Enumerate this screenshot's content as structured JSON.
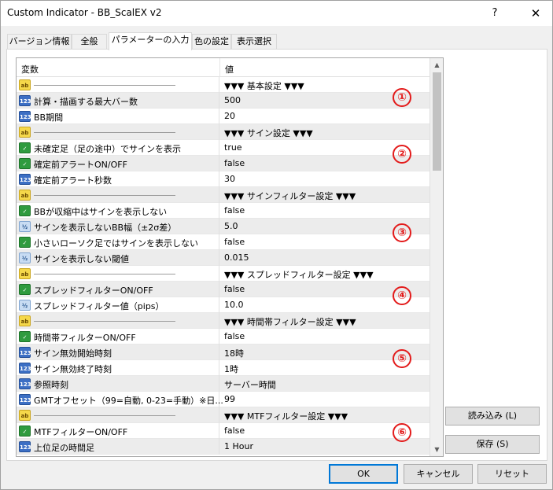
{
  "window": {
    "title": "Custom Indicator - BB_ScalEX v2",
    "help_label": "?",
    "close_label": "✕"
  },
  "tabs": [
    {
      "label": "バージョン情報"
    },
    {
      "label": "全般"
    },
    {
      "label": "パラメーターの入力"
    },
    {
      "label": "色の設定"
    },
    {
      "label": "表示選択"
    }
  ],
  "grid": {
    "header_variable": "変数",
    "header_value": "値"
  },
  "rows": [
    {
      "type": "ab",
      "icon": "ab",
      "variable": "",
      "value": "▼▼▼ 基本設定 ▼▼▼",
      "separator": true
    },
    {
      "type": "int",
      "icon": "123",
      "variable": "計算・描画する最大バー数",
      "value": "500"
    },
    {
      "type": "int",
      "icon": "123",
      "variable": "BB期間",
      "value": "20"
    },
    {
      "type": "ab",
      "icon": "ab",
      "variable": "",
      "value": "▼▼▼ サイン設定 ▼▼▼",
      "separator": true
    },
    {
      "type": "bool",
      "icon": "✓",
      "variable": "未確定足（足の途中）でサインを表示",
      "value": "true"
    },
    {
      "type": "bool",
      "icon": "✓",
      "variable": "確定前アラートON/OFF",
      "value": "false"
    },
    {
      "type": "int",
      "icon": "123",
      "variable": "確定前アラート秒数",
      "value": "30"
    },
    {
      "type": "ab",
      "icon": "ab",
      "variable": "",
      "value": "▼▼▼ サインフィルター設定 ▼▼▼",
      "separator": true
    },
    {
      "type": "bool",
      "icon": "✓",
      "variable": "BBが収縮中はサインを表示しない",
      "value": "false"
    },
    {
      "type": "dbl",
      "icon": "½",
      "variable": "サインを表示しないBB幅（±2σ差）",
      "value": "5.0"
    },
    {
      "type": "bool",
      "icon": "✓",
      "variable": "小さいローソク足ではサインを表示しない",
      "value": "false"
    },
    {
      "type": "dbl",
      "icon": "½",
      "variable": "サインを表示しない閾値",
      "value": "0.015"
    },
    {
      "type": "ab",
      "icon": "ab",
      "variable": "",
      "value": "▼▼▼ スプレッドフィルター設定 ▼▼▼",
      "separator": true
    },
    {
      "type": "bool",
      "icon": "✓",
      "variable": "スプレッドフィルターON/OFF",
      "value": "false"
    },
    {
      "type": "dbl",
      "icon": "½",
      "variable": "スプレッドフィルター値（pips）",
      "value": "10.0"
    },
    {
      "type": "ab",
      "icon": "ab",
      "variable": "",
      "value": "▼▼▼ 時間帯フィルター設定 ▼▼▼",
      "separator": true
    },
    {
      "type": "bool",
      "icon": "✓",
      "variable": "時間帯フィルターON/OFF",
      "value": "false"
    },
    {
      "type": "int",
      "icon": "123",
      "variable": "サイン無効開始時刻",
      "value": "18時"
    },
    {
      "type": "int",
      "icon": "123",
      "variable": "サイン無効終了時刻",
      "value": "1時"
    },
    {
      "type": "int",
      "icon": "123",
      "variable": "参照時刻",
      "value": "サーバー時間"
    },
    {
      "type": "int",
      "icon": "123",
      "variable": "GMTオフセット（99=自動, 0-23=手動）※日...",
      "value": "99"
    },
    {
      "type": "ab",
      "icon": "ab",
      "variable": "",
      "value": "▼▼▼ MTFフィルター設定 ▼▼▼",
      "separator": true
    },
    {
      "type": "bool",
      "icon": "✓",
      "variable": "MTFフィルターON/OFF",
      "value": "false"
    },
    {
      "type": "int",
      "icon": "123",
      "variable": "上位足の時間足",
      "value": "1 Hour"
    }
  ],
  "annotations": [
    "①",
    "②",
    "③",
    "④",
    "⑤",
    "⑥"
  ],
  "side_buttons": {
    "load_label": "読み込み (L)",
    "save_label": "保存 (S)"
  },
  "footer": {
    "ok_label": "OK",
    "cancel_label": "キャンセル",
    "reset_label": "リセット"
  }
}
